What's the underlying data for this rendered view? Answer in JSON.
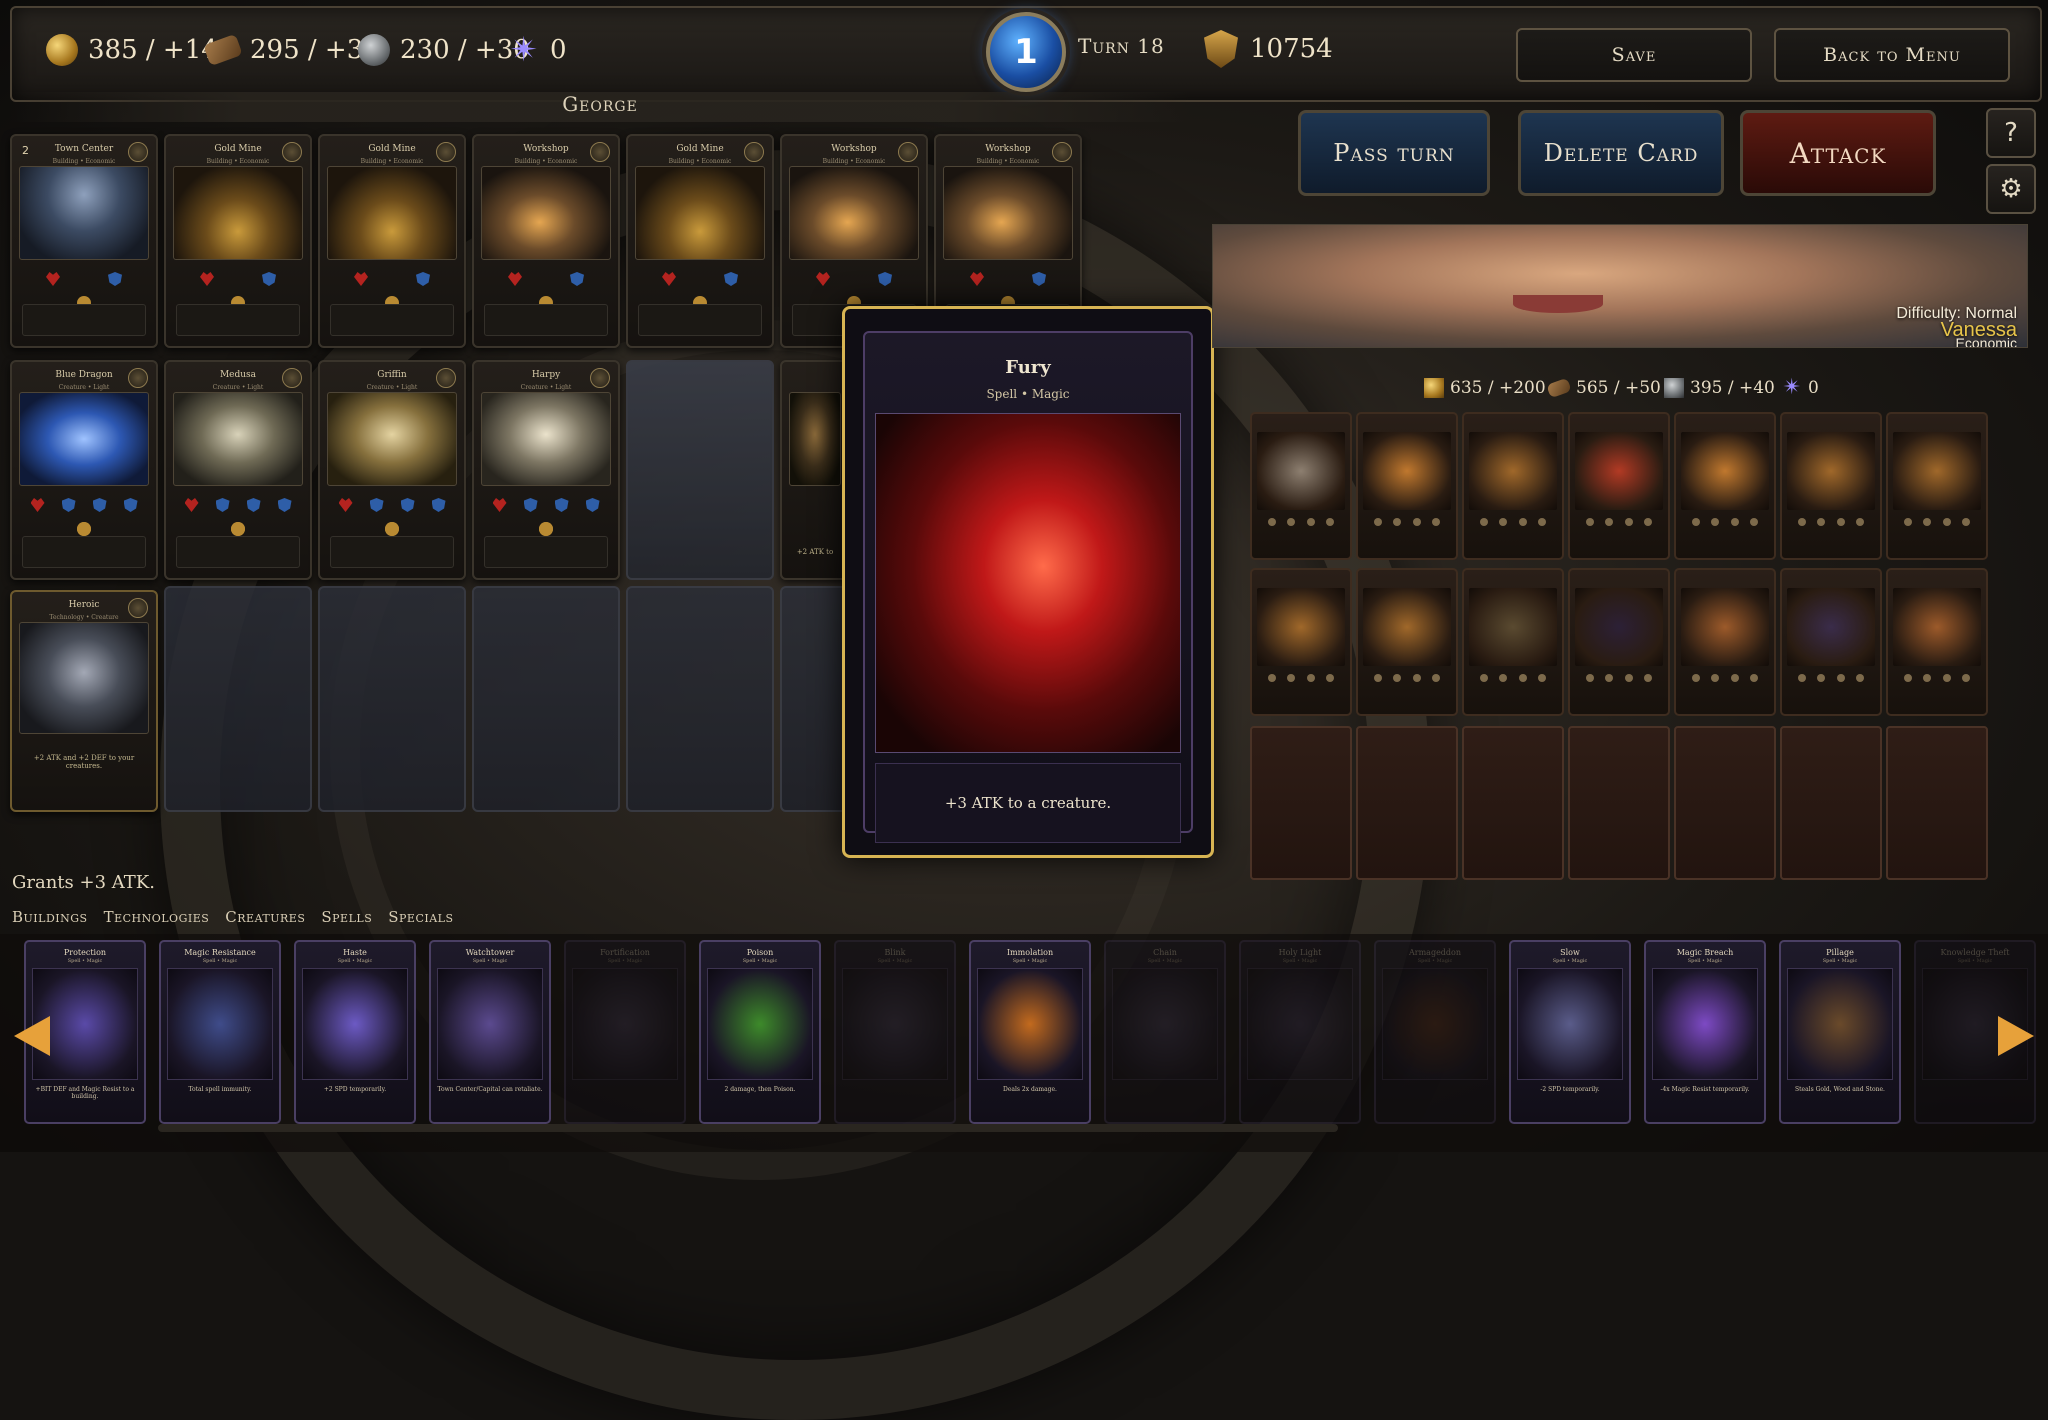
{
  "resources": {
    "gold": "385 / +140",
    "wood": "295 / +30",
    "stone": "230 / +30",
    "mana": "0"
  },
  "turn": {
    "number": "1",
    "label": "Turn 18"
  },
  "score": "10754",
  "buttons": {
    "save": "Save",
    "back_to_menu": "Back to Menu",
    "pass_turn": "Pass turn",
    "delete_card": "Delete Card",
    "attack": "Attack",
    "help": "?"
  },
  "player": {
    "name": "George",
    "buildings": [
      {
        "num": "2",
        "name": "Town Center",
        "sub": "Building • Economic",
        "art": "town"
      },
      {
        "name": "Gold Mine",
        "sub": "Building • Economic",
        "art": "gold"
      },
      {
        "name": "Gold Mine",
        "sub": "Building • Economic",
        "art": "gold"
      },
      {
        "name": "Workshop",
        "sub": "Building • Economic",
        "art": "shop"
      },
      {
        "name": "Gold Mine",
        "sub": "Building • Economic",
        "art": "gold"
      },
      {
        "name": "Workshop",
        "sub": "Building • Economic",
        "art": "shop"
      },
      {
        "name": "Workshop",
        "sub": "Building • Economic",
        "art": "shop"
      }
    ],
    "creatures": [
      {
        "name": "Blue Dragon",
        "sub": "Creature • Light",
        "art": "dragon"
      },
      {
        "name": "Medusa",
        "sub": "Creature • Light",
        "art": "medusa"
      },
      {
        "name": "Griffin",
        "sub": "Creature • Light",
        "art": "griffin"
      },
      {
        "name": "Harpy",
        "sub": "Creature • Light",
        "art": "harpy"
      }
    ],
    "partial_card_text": "+2 ATK to",
    "technology": {
      "name": "Heroic",
      "sub": "Technology • Creature",
      "text": "+2 ATK and +2 DEF to your creatures."
    }
  },
  "hover_card": {
    "name": "Fury",
    "type": "Spell • Magic",
    "desc": "+3 ATK to a creature."
  },
  "opponent": {
    "difficulty": "Difficulty: Normal",
    "name": "Vanessa",
    "style": "Economic",
    "resources": {
      "gold": "635 / +200",
      "wood": "565 / +50",
      "stone": "395 / +40",
      "mana": "0"
    }
  },
  "description_bar": "Grants +3 ATK.",
  "categories": [
    "Buildings",
    "Technologies",
    "Creatures",
    "Spells",
    "Specials"
  ],
  "hand": [
    {
      "name": "Protection",
      "sub": "Spell • Magic",
      "desc": "+BIT DEF and Magic Resist to a building.",
      "dim": false,
      "color": "#5a4aa8"
    },
    {
      "name": "Magic Resistance",
      "sub": "Spell • Magic",
      "desc": "Total spell immunity.",
      "dim": false,
      "color": "#3f4c8a"
    },
    {
      "name": "Haste",
      "sub": "Spell • Magic",
      "desc": "+2 SPD temporarily.",
      "dim": false,
      "color": "#6c5ac4"
    },
    {
      "name": "Watchtower",
      "sub": "Spell • Magic",
      "desc": "Town Center/Capital can retaliate.",
      "dim": false,
      "color": "#5b4a8f"
    },
    {
      "name": "Fortification",
      "sub": "Spell • Magic",
      "desc": "",
      "dim": true,
      "color": "#4a4060"
    },
    {
      "name": "Poison",
      "sub": "Spell • Magic",
      "desc": "2 damage, then Poison.",
      "dim": false,
      "color": "#3d8a2a"
    },
    {
      "name": "Blink",
      "sub": "Spell • Magic",
      "desc": "",
      "dim": true,
      "color": "#4a4060"
    },
    {
      "name": "Immolation",
      "sub": "Spell • Magic",
      "desc": "Deals 2x damage.",
      "dim": false,
      "color": "#c26a1e"
    },
    {
      "name": "Chain",
      "sub": "Spell • Magic",
      "desc": "",
      "dim": true,
      "color": "#4a4060"
    },
    {
      "name": "Holy Light",
      "sub": "Spell • Magic",
      "desc": "",
      "dim": true,
      "color": "#4a4060"
    },
    {
      "name": "Armageddon",
      "sub": "Spell • Magic",
      "desc": "",
      "dim": true,
      "color": "#6a3820"
    },
    {
      "name": "Slow",
      "sub": "Spell • Magic",
      "desc": "-2 SPD temporarily.",
      "dim": false,
      "color": "#5a5c8a"
    },
    {
      "name": "Magic Breach",
      "sub": "Spell • Magic",
      "desc": "-4x Magic Resist temporarily.",
      "dim": false,
      "color": "#7d4ac4"
    },
    {
      "name": "Pillage",
      "sub": "Spell • Magic",
      "desc": "Steals Gold, Wood and Stone.",
      "dim": false,
      "color": "#6a4a2a"
    },
    {
      "name": "Knowledge Theft",
      "sub": "Spell • Magic",
      "desc": "",
      "dim": true,
      "color": "#4a4060"
    }
  ],
  "colors": {
    "accent_gold": "#d7b453",
    "attack_red": "#5e1b12",
    "panel_blue": "#1e3550",
    "mana_purple": "#9b8cff"
  },
  "icons": [
    "gold-icon",
    "wood-icon",
    "stone-icon",
    "mana-icon",
    "score-shield-icon",
    "gear-icon",
    "arrow-left-icon",
    "arrow-right-icon"
  ]
}
